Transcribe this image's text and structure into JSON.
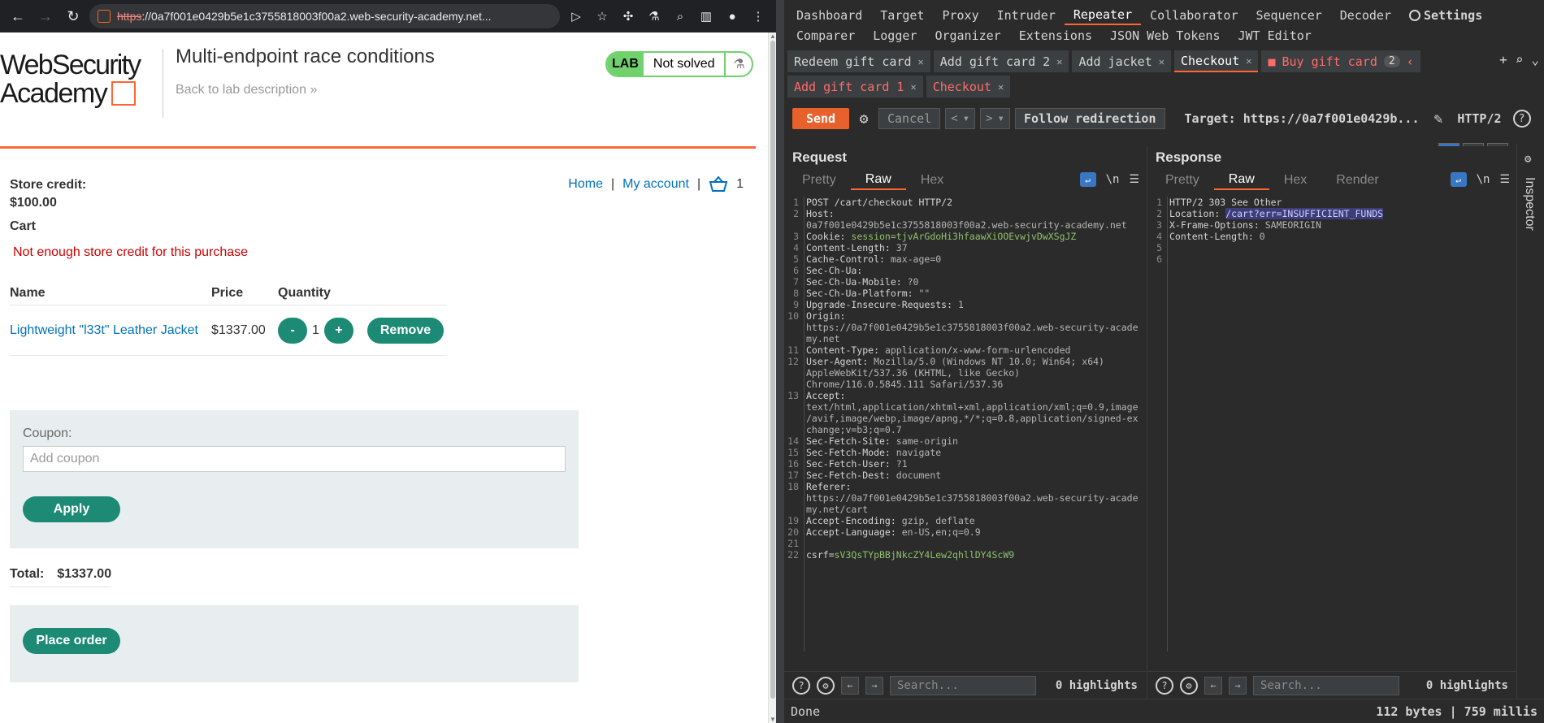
{
  "browser": {
    "url_scheme": "https",
    "url_host": "://0a7f001e0429b5e1c3755818003f00a2.web-security-academy.net..."
  },
  "lab": {
    "logo_line1": "WebSecurity",
    "logo_line2": "Academy",
    "title": "Multi-endpoint race conditions",
    "back_link": "Back to lab description",
    "badge": "LAB",
    "status": "Not solved"
  },
  "shop": {
    "store_credit_label": "Store credit:",
    "store_credit_value": "$100.00",
    "nav_home": "Home",
    "nav_sep": "|",
    "nav_account": "My account",
    "cart_count": "1",
    "cart_heading": "Cart",
    "error": "Not enough store credit for this purchase",
    "columns": [
      "Name",
      "Price",
      "Quantity"
    ],
    "item": {
      "name": "Lightweight \"l33t\" Leather Jacket",
      "price": "$1337.00",
      "minus": "-",
      "qty": "1",
      "plus": "+",
      "remove": "Remove"
    },
    "coupon_label": "Coupon:",
    "coupon_placeholder": "Add coupon",
    "apply": "Apply",
    "total_label": "Total:",
    "total_value": "$1337.00",
    "place_order": "Place order"
  },
  "burp": {
    "nav_row1": [
      "Dashboard",
      "Target",
      "Proxy",
      "Intruder",
      "Repeater",
      "Collaborator",
      "Sequencer",
      "Decoder"
    ],
    "settings": "Settings",
    "nav_row2": [
      "Comparer",
      "Logger",
      "Organizer",
      "Extensions",
      "JSON Web Tokens",
      "JWT Editor"
    ],
    "tabs_row1": [
      "Redeem gift card",
      "Add gift card 2",
      "Add jacket",
      "Checkout"
    ],
    "group_tab": "Buy gift card",
    "group_count": "2",
    "tabs_row2": [
      "Add gift card 1",
      "Checkout"
    ],
    "send": "Send",
    "cancel": "Cancel",
    "follow": "Follow redirection",
    "target": "Target: https://0a7f001e0429b...",
    "http_version": "HTTP/2",
    "request_title": "Request",
    "response_title": "Response",
    "request_tabs": [
      "Pretty",
      "Raw",
      "Hex"
    ],
    "response_tabs": [
      "Pretty",
      "Raw",
      "Hex",
      "Render"
    ],
    "newline_toggle": "\\n",
    "search_placeholder": "Search...",
    "highlights": "0 highlights",
    "inspector": "Inspector",
    "status_left": "Done",
    "status_right": "112 bytes | 759 millis",
    "request_lines": [
      {
        "n": "1",
        "k": "POST /cart/checkout HTTP/2",
        "v": ""
      },
      {
        "n": "2",
        "k": "Host:",
        "v": ""
      },
      {
        "n": "",
        "k": "",
        "v": "0a7f001e0429b5e1c3755818003f00a2.web-security-academy.net"
      },
      {
        "n": "3",
        "k": "Cookie: ",
        "v": "session=tjvArGdoHi3hfaawXiOOEvwjvDwXSgJZ"
      },
      {
        "n": "4",
        "k": "Content-Length:",
        "v": " 37"
      },
      {
        "n": "5",
        "k": "Cache-Control:",
        "v": " max-age=0"
      },
      {
        "n": "6",
        "k": "Sec-Ch-Ua:",
        "v": ""
      },
      {
        "n": "7",
        "k": "Sec-Ch-Ua-Mobile:",
        "v": " ?0"
      },
      {
        "n": "8",
        "k": "Sec-Ch-Ua-Platform:",
        "v": " \"\""
      },
      {
        "n": "9",
        "k": "Upgrade-Insecure-Requests:",
        "v": " 1"
      },
      {
        "n": "10",
        "k": "Origin:",
        "v": ""
      },
      {
        "n": "",
        "k": "",
        "v": "https://0a7f001e0429b5e1c3755818003f00a2.web-security-acade"
      },
      {
        "n": "",
        "k": "",
        "v": "my.net"
      },
      {
        "n": "11",
        "k": "Content-Type:",
        "v": " application/x-www-form-urlencoded"
      },
      {
        "n": "12",
        "k": "User-Agent:",
        "v": " Mozilla/5.0 (Windows NT 10.0; Win64; x64)"
      },
      {
        "n": "",
        "k": "",
        "v": "AppleWebKit/537.36 (KHTML, like Gecko)"
      },
      {
        "n": "",
        "k": "",
        "v": "Chrome/116.0.5845.111 Safari/537.36"
      },
      {
        "n": "13",
        "k": "Accept:",
        "v": ""
      },
      {
        "n": "",
        "k": "",
        "v": "text/html,application/xhtml+xml,application/xml;q=0.9,image"
      },
      {
        "n": "",
        "k": "",
        "v": "/avif,image/webp,image/apng,*/*;q=0.8,application/signed-ex"
      },
      {
        "n": "",
        "k": "",
        "v": "change;v=b3;q=0.7"
      },
      {
        "n": "14",
        "k": "Sec-Fetch-Site:",
        "v": " same-origin"
      },
      {
        "n": "15",
        "k": "Sec-Fetch-Mode:",
        "v": " navigate"
      },
      {
        "n": "16",
        "k": "Sec-Fetch-User:",
        "v": " ?1"
      },
      {
        "n": "17",
        "k": "Sec-Fetch-Dest:",
        "v": " document"
      },
      {
        "n": "18",
        "k": "Referer:",
        "v": ""
      },
      {
        "n": "",
        "k": "",
        "v": "https://0a7f001e0429b5e1c3755818003f00a2.web-security-acade"
      },
      {
        "n": "",
        "k": "",
        "v": "my.net/cart"
      },
      {
        "n": "19",
        "k": "Accept-Encoding:",
        "v": " gzip, deflate"
      },
      {
        "n": "20",
        "k": "Accept-Language:",
        "v": " en-US,en;q=0.9"
      },
      {
        "n": "21",
        "k": "",
        "v": ""
      },
      {
        "n": "22",
        "k": "csrf=",
        "v": "sV3QsTYpBBjNkcZY4Lew2qhllDY4ScW9"
      }
    ],
    "response_lines": [
      {
        "n": "1",
        "k": "HTTP/2 303 See Other",
        "v": ""
      },
      {
        "n": "2",
        "k": "Location: ",
        "v": "/cart?err=INSUFFICIENT_FUNDS"
      },
      {
        "n": "3",
        "k": "X-Frame-Options:",
        "v": " SAMEORIGIN"
      },
      {
        "n": "4",
        "k": "Content-Length:",
        "v": " 0"
      },
      {
        "n": "5",
        "k": "",
        "v": ""
      },
      {
        "n": "6",
        "k": "",
        "v": ""
      }
    ]
  }
}
